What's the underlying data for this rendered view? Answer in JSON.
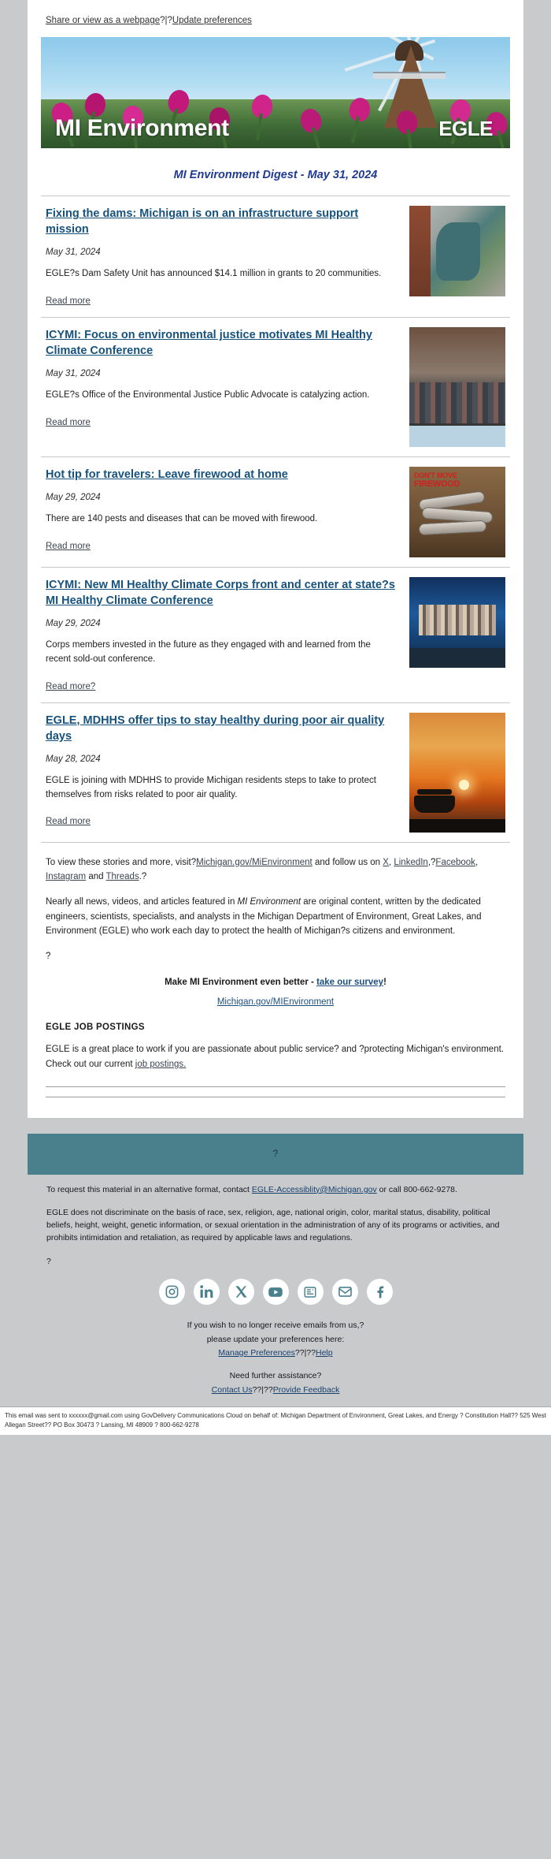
{
  "preheader": {
    "share_link": "Share or view as a webpage",
    "separator": "?|?",
    "preferences_link": "Update preferences"
  },
  "banner": {
    "title": "MI Environment",
    "logo": "EGLE"
  },
  "digest": {
    "title": "MI Environment Digest - May 31, 2024"
  },
  "articles": [
    {
      "title": "Fixing the dams: Michigan is on an infrastructure support mission",
      "date": "May 31, 2024",
      "description": "EGLE?s Dam Safety Unit has announced $14.1 million in grants to 20 communities.",
      "read_more": "Read more",
      "image_alt": "aerial-dam-river-rendering"
    },
    {
      "title": "ICYMI: Focus on environmental justice motivates MI Healthy Climate Conference",
      "date": "May 31, 2024",
      "description": "EGLE?s Office of the Environmental Justice Public Advocate is catalyzing action.",
      "read_more": "Read more",
      "image_alt": "conference-group-photo"
    },
    {
      "title": "Hot tip for travelers: Leave firewood at home",
      "date": "May 29, 2024",
      "description": "There are 140 pests and diseases that can be moved with firewood.",
      "read_more": "Read more",
      "image_alt": "dont-move-firewood-poster"
    },
    {
      "title": "ICYMI: New MI Healthy Climate Corps front and center at state?s MI Healthy Climate Conference",
      "date": "May 29, 2024",
      "description": "Corps members invested in the future as they engaged with and learned from the recent sold-out conference.",
      "read_more": "Read more?",
      "image_alt": "climate-corps-stage-photo"
    },
    {
      "title": "EGLE, MDHHS offer tips to stay healthy during poor air quality days",
      "date": "May 28, 2024",
      "description": "EGLE is joining with MDHHS to provide Michigan residents steps to take to protect themselves from risks related to poor air quality.",
      "read_more": "Read more",
      "image_alt": "lake-sunset-pontoon-boat"
    }
  ],
  "closing": {
    "line1_pre": "To view these stories and more, visit?",
    "link_mienv": "Michigan.gov/MiEnvironment",
    "line1_mid": " and follow us on ",
    "link_x": "X",
    "after_x": ", ",
    "link_linkedin": "LinkedIn",
    "after_linkedin": ",?",
    "link_facebook": "Facebook",
    "after_facebook": ", ",
    "link_instagram": "Instagram",
    "after_instagram": " and ",
    "link_threads": "Threads",
    "line1_end": ".?",
    "paragraph2_a": "Nearly all news, videos, and articles featured in ",
    "paragraph2_em": "MI Environment",
    "paragraph2_b": " are original content, written by the dedicated engineers, scientists, specialists, and analysts in the Michigan Department of Environment, Great Lakes, and Environment (EGLE) who work each day to protect the health of Michigan?s citizens and environment.",
    "question_mark": "?",
    "survey_pre": "Make MI Environment even better - ",
    "survey_link": "take our survey",
    "survey_post": "!",
    "center_link": "Michigan.gov/MIEnvironment",
    "jobs_heading": "EGLE JOB POSTINGS",
    "jobs_text_a": "EGLE is a great place to work if you are passionate about public service? and ?protecting Michigan's environment. Check out our current ",
    "jobs_link": "job postings.",
    "jobs_text_b": ""
  },
  "teal_bar": {
    "text": "?"
  },
  "footer": {
    "accessibility_a": "To request this material in an alternative format, contact ",
    "accessibility_link": "EGLE-Accessiblity@Michigan.gov",
    "accessibility_b": " or call 800-662-9278.",
    "nondiscrimination": "EGLE does not discriminate on the basis of race, sex, religion, age, national origin, color, marital status, disability, political beliefs, height, weight, genetic information, or sexual orientation in the administration of any of its programs or activities, and prohibits intimidation and retaliation, as required by applicable laws and regulations.",
    "lone_question": "?",
    "social_icons": [
      "instagram-icon",
      "linkedin-icon",
      "x-twitter-icon",
      "youtube-icon",
      "news-icon",
      "email-icon",
      "facebook-icon"
    ],
    "unsubscribe_line1": "If you wish to no longer receive emails from us,?",
    "unsubscribe_line2": "please update your preferences here:",
    "manage_preferences": "Manage Preferences",
    "sep1": "??|??",
    "help_link": "Help",
    "assistance_line": "Need further assistance?",
    "contact_us": "Contact Us",
    "sep2": "??|??",
    "provide_feedback": "Provide Feedback"
  },
  "bottom_bar": {
    "text": "This email was sent to xxxxxx@gmail.com using GovDelivery Communications Cloud on behalf of: Michigan Department of Environment, Great Lakes, and Energy ? Constitution Hall?? 525 West Allegan Street?? PO Box 30473 ? Lansing, MI 48909 ? 800-662-9278"
  },
  "colors": {
    "link_blue": "#17527d",
    "digest_blue": "#1f3a93",
    "teal": "#4a808c",
    "page_bg": "#c8cacc"
  }
}
